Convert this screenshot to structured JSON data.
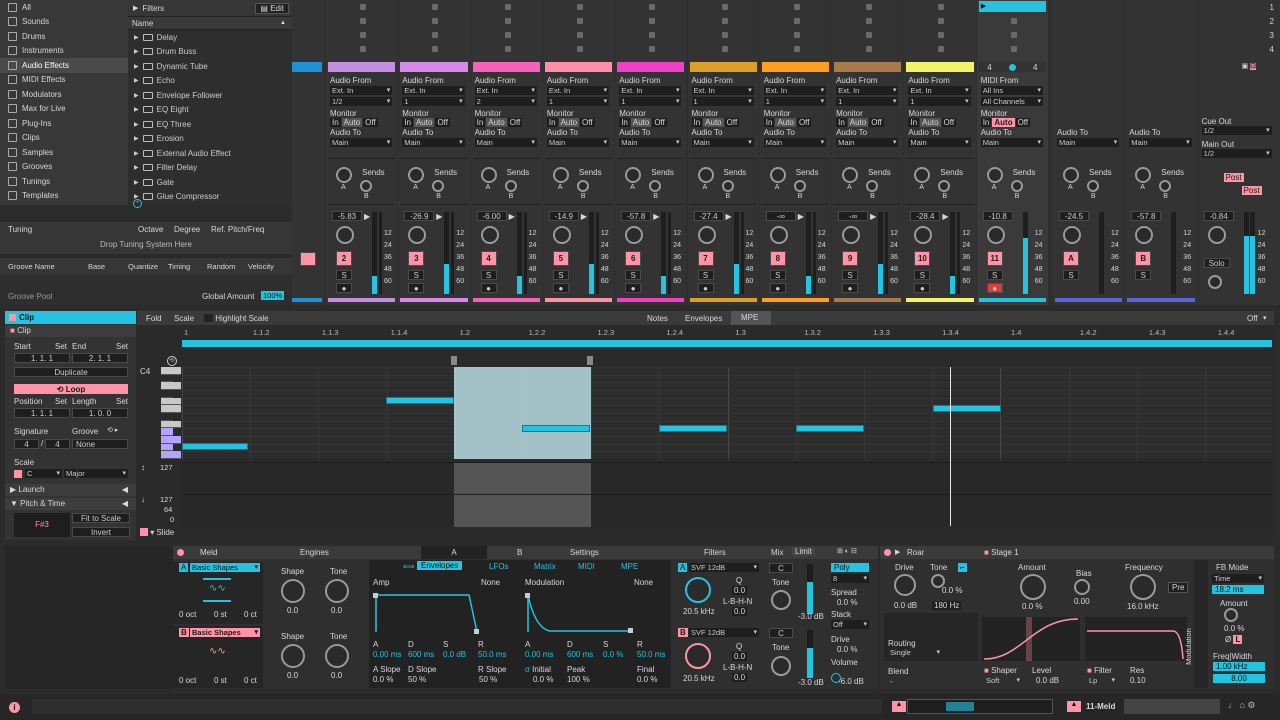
{
  "sidebar": {
    "items": [
      {
        "label": "All",
        "icon": "grid-icon"
      },
      {
        "label": "Sounds",
        "icon": "sounds-icon"
      },
      {
        "label": "Drums",
        "icon": "drums-icon"
      },
      {
        "label": "Instruments",
        "icon": "instruments-icon"
      },
      {
        "label": "Audio Effects",
        "icon": "audio-effects-icon",
        "selected": true
      },
      {
        "label": "MIDI Effects",
        "icon": "midi-effects-icon"
      },
      {
        "label": "Modulators",
        "icon": "modulators-icon"
      },
      {
        "label": "Max for Live",
        "icon": "max-icon"
      },
      {
        "label": "Plug-Ins",
        "icon": "plugin-icon"
      },
      {
        "label": "Clips",
        "icon": "clips-icon"
      },
      {
        "label": "Samples",
        "icon": "samples-icon"
      },
      {
        "label": "Grooves",
        "icon": "grooves-icon"
      },
      {
        "label": "Tunings",
        "icon": "tunings-icon"
      },
      {
        "label": "Templates",
        "icon": "templates-icon"
      }
    ]
  },
  "browser": {
    "filters_label": "Filters",
    "edit_label": "Edit",
    "name_header": "Name",
    "items": [
      "Delay",
      "Drum Buss",
      "Dynamic Tube",
      "Echo",
      "Envelope Follower",
      "EQ Eight",
      "EQ Three",
      "Erosion",
      "External Audio Effect",
      "Filter Delay",
      "Gate",
      "Glue Compressor"
    ]
  },
  "tuning": {
    "label": "Tuning",
    "octave": "Octave",
    "degree": "Degree",
    "ref": "Ref. Pitch/Freq",
    "drop": "Drop Tuning System Here"
  },
  "groove": {
    "cols": [
      "Groove Name",
      "Base",
      "Quantize",
      "Timing",
      "Random",
      "Velocity"
    ],
    "pool": "Groove Pool",
    "global_label": "Global Amount",
    "global_value": "100%"
  },
  "tracks": [
    {
      "color": "#c38ee0",
      "vol": "-5.83",
      "num": "2",
      "in": "Ext. In",
      "ch": "1/2",
      "mon": "Auto"
    },
    {
      "color": "#d689e8",
      "vol": "-26.9",
      "num": "3",
      "in": "Ext. In",
      "ch": "1",
      "mon": "Auto"
    },
    {
      "color": "#f561b8",
      "vol": "-6.00",
      "num": "4",
      "in": "Ext. In",
      "ch": "2",
      "mon": "Auto"
    },
    {
      "color": "#ff8fa8",
      "vol": "-14.9",
      "num": "5",
      "in": "Ext. In",
      "ch": "1",
      "mon": "Auto"
    },
    {
      "color": "#f040c8",
      "vol": "-57.8",
      "num": "6",
      "in": "Ext. In",
      "ch": "1",
      "mon": "Auto"
    },
    {
      "color": "#dca02a",
      "vol": "-27.4",
      "num": "7",
      "in": "Ext. In",
      "ch": "1",
      "mon": "Auto"
    },
    {
      "color": "#ff9e22",
      "vol": "-∞",
      "num": "8",
      "in": "Ext. In",
      "ch": "1",
      "mon": "Auto"
    },
    {
      "color": "#a77a4e",
      "vol": "-∞",
      "num": "9",
      "in": "Ext. In",
      "ch": "1",
      "mon": "Auto"
    },
    {
      "color": "#f3f36a",
      "vol": "-28.4",
      "num": "10",
      "in": "Ext. In",
      "ch": "1",
      "mon": "Auto"
    }
  ],
  "midi_track": {
    "from": "MIDI From",
    "in": "All Ins",
    "ch": "All Channels",
    "vol": "-10.8",
    "num": "11",
    "color": "#25c3e0"
  },
  "returns": [
    {
      "vol": "-24.5",
      "letter": "A"
    },
    {
      "vol": "-57.8",
      "letter": "B"
    }
  ],
  "master": {
    "cue": "Cue Out",
    "cue_val": "1/2",
    "main": "Main Out",
    "main_val": "1/2",
    "vol": "-0.84",
    "solo": "Solo",
    "post": "Post"
  },
  "mixer_labels": {
    "audio_from": "Audio From",
    "monitor": "Monitor",
    "in": "In",
    "auto": "Auto",
    "off": "Off",
    "audio_to": "Audio To",
    "main": "Main",
    "sends": "Sends",
    "s": "S",
    "a": "A",
    "b": "B",
    "db_scale": [
      "12",
      "24",
      "36",
      "48",
      "60"
    ]
  },
  "scene_nums": [
    "1",
    "2",
    "3",
    "4"
  ],
  "midi_slot": {
    "left": "4",
    "right": "4"
  },
  "clip": {
    "title": "Clip",
    "sub": "Clip",
    "start": "Start",
    "set": "Set",
    "end": "End",
    "start_v": "1.  1.  1",
    "end_v": "2.  1.  1",
    "duplicate": "Duplicate",
    "loop": "Loop",
    "position": "Position",
    "length": "Length",
    "pos_v": "1.  1.  1",
    "len_v": "1.  0.  0",
    "signature": "Signature",
    "sig_num": "4",
    "sig_den": "4",
    "groove": "Groove",
    "groove_v": "None",
    "scale": "Scale",
    "scale_root": "C",
    "scale_name": "Major",
    "launch": "Launch",
    "pitch_time": "Pitch & Time",
    "pitch_note": "F#3",
    "fit": "Fit to Scale",
    "invert": "Invert"
  },
  "editor": {
    "fold": "Fold",
    "scale": "Scale",
    "highlight": "Highlight Scale",
    "tabs": [
      "Notes",
      "Envelopes",
      "MPE"
    ],
    "off": "Off",
    "c4": "C4",
    "vel_top": "127",
    "vel_max": "127",
    "vel_mid": "64",
    "vel_min": "0",
    "slide": "Slide",
    "ruler": [
      "1",
      "1.1.2",
      "1.1.3",
      "1.1.4",
      "1.2",
      "1.2.2",
      "1.2.3",
      "1.2.4",
      "1.3",
      "1.3.2",
      "1.3.3",
      "1.3.4",
      "1.4",
      "1.4.2",
      "1.4.3",
      "1.4.4"
    ]
  },
  "meld": {
    "name": "Meld",
    "engines": "Engines",
    "tabs": [
      "A",
      "B",
      "Settings"
    ],
    "osc_a": "Basic Shapes",
    "osc_b": "Basic Shapes",
    "shape": "Shape",
    "tone": "Tone",
    "zero": "0.0",
    "oct": "0 oct",
    "st": "0 st",
    "ct": "0 ct",
    "env_tab": "Envelopes",
    "lfo_tab": "LFOs",
    "matrix_tab": "Matrix",
    "midi_tab": "MIDI",
    "mpe_tab": "MPE",
    "amp": "Amp",
    "none": "None",
    "modulation": "Modulation",
    "adsr": [
      "A",
      "D",
      "S",
      "R"
    ],
    "amp_vals": [
      "0.00 ms",
      "600 ms",
      "0.0 dB",
      "50.0 ms"
    ],
    "mod_vals": [
      "0.00 ms",
      "600 ms",
      "0.0 %",
      "50.0 ms"
    ],
    "a_slope": "A Slope",
    "d_slope": "D Slope",
    "r_slope": "R Slope",
    "a_slope_v": "0.0 %",
    "d_slope_v": "50 %",
    "r_slope_v": "50 %",
    "initial": "Initial",
    "peak": "Peak",
    "final": "Final",
    "initial_v": "0.0 %",
    "peak_v": "100 %",
    "final_v": "0.0 %",
    "filters": "Filters",
    "mix": "Mix",
    "limit": "Limit",
    "svf": "SVF 12dB",
    "freq": "20.5 kHz",
    "q": "Q",
    "q_v": "0.0",
    "lbhn": "L-B-H-N",
    "lbhn_v": "0.0",
    "c": "C",
    "tone_db": "-3.0 dB",
    "poly": "Poly",
    "voices": "8",
    "spread": "Spread",
    "spread_v": "0.0 %",
    "stack": "Stack",
    "stack_v": "Off",
    "drive": "Drive",
    "drive_v": "0.0 %",
    "volume": "Volume",
    "volume_v": "-6.0 dB"
  },
  "roar": {
    "name": "Roar",
    "drive": "Drive",
    "tone": "Tone",
    "drive_v": "0.0 dB",
    "tone_v": "0.0 %",
    "freq_v": "180 Hz",
    "routing": "Routing",
    "single": "Single",
    "blend": "Blend",
    "blend_v": "-",
    "stage": "Stage 1",
    "amount": "Amount",
    "amount_v": "0.0 %",
    "bias": "Bias",
    "bias_v": "0.00",
    "frequency": "Frequency",
    "freq2_v": "16.0 kHz",
    "pre": "Pre",
    "shaper": "Shaper",
    "soft": "Soft",
    "level": "Level",
    "level_v": "0.0 dB",
    "filter": "Filter",
    "lp": "Lp",
    "res": "Res",
    "res_v": "0.10",
    "modulation": "Modulation",
    "fb_mode": "FB Mode",
    "time": "Time",
    "time_v": "18.2 ms",
    "amount2": "Amount",
    "amount2_v": "0.0 %",
    "freq_width": "Freq|Width",
    "fw_v": "1.00 kHz",
    "fw2_v": "8.00"
  },
  "status": {
    "track_name": "11-Meld"
  }
}
